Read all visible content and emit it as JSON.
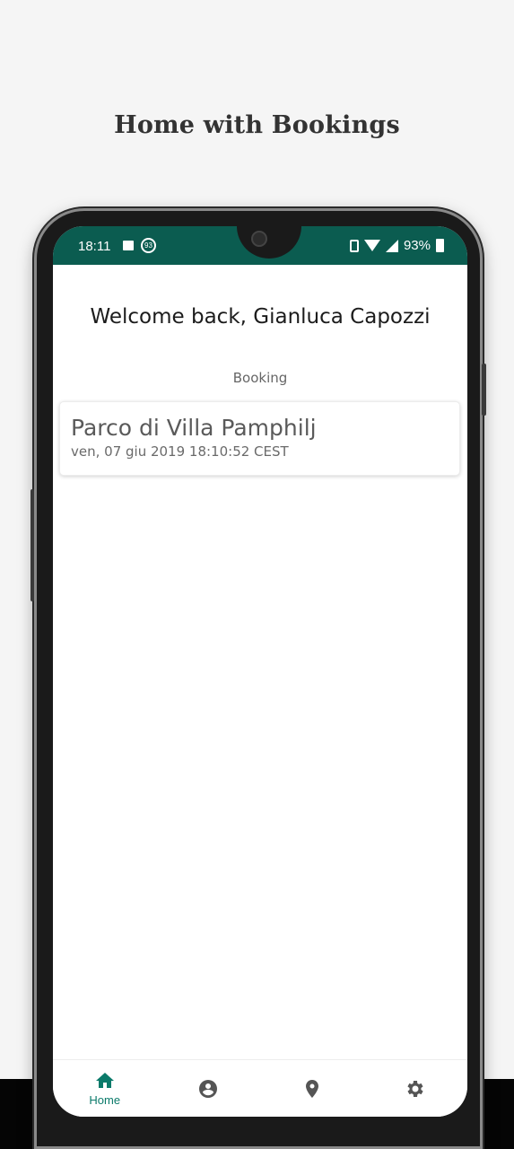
{
  "headline": "Home with Bookings",
  "status_bar": {
    "time": "18:11",
    "badge": "93",
    "battery": "93%"
  },
  "welcome_text": "Welcome back, Gianluca Capozzi",
  "section_label": "Booking",
  "bookings": [
    {
      "title": "Parco di Villa Pamphilj",
      "date": "ven, 07 giu 2019 18:10:52 CEST"
    }
  ],
  "bottom_nav": [
    {
      "label": "Home",
      "icon": "home-icon",
      "active": true
    },
    {
      "label": "",
      "icon": "account-icon",
      "active": false
    },
    {
      "label": "",
      "icon": "location-pin-icon",
      "active": false
    },
    {
      "label": "",
      "icon": "settings-icon",
      "active": false
    }
  ],
  "colors": {
    "status_bar": "#0b5c50",
    "accent": "#0b7a6a",
    "background": "#f5f5f5"
  }
}
